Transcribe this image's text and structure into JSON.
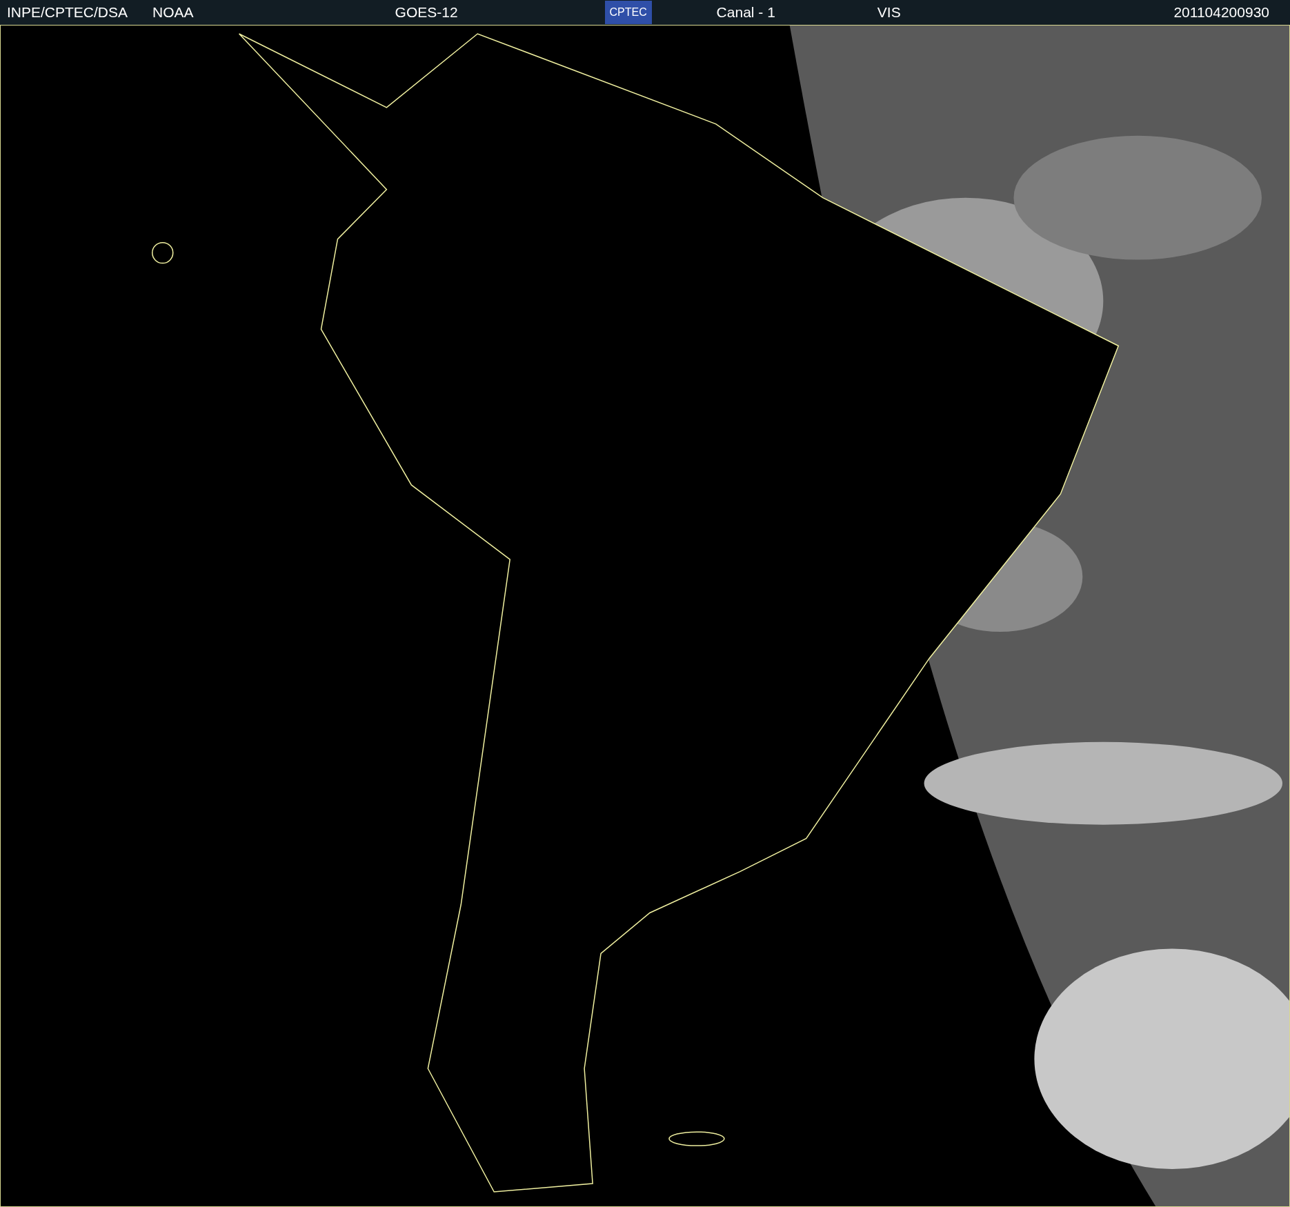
{
  "header": {
    "left": [
      {
        "text": "INPE/CPTEC/DSA"
      },
      {
        "text": "NOAA"
      }
    ],
    "satellite": "GOES-12",
    "logo": "CPTEC",
    "channel": "Canal - 1",
    "band": "VIS",
    "timestamp": "201104200930"
  }
}
